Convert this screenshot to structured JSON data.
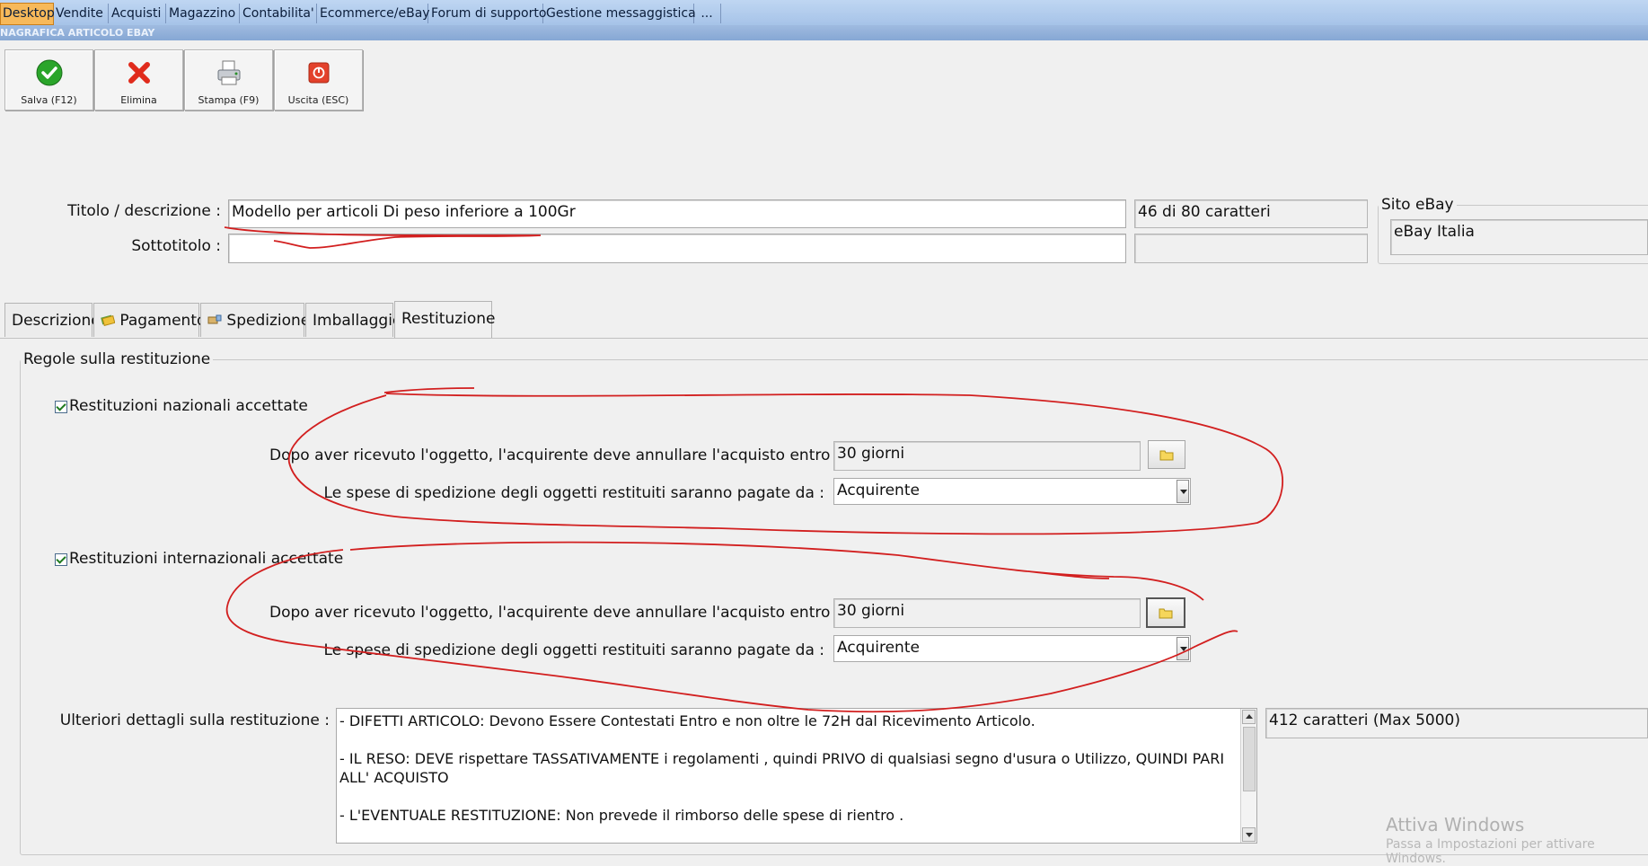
{
  "menu": {
    "tabs": [
      "Desktop",
      "Vendite",
      "Acquisti",
      "Magazzino",
      "Contabilita'",
      "Ecommerce/eBay",
      "Forum di supporto",
      "Gestione messaggistica",
      "..."
    ],
    "window_title": "NAGRAFICA ARTICOLO EBAY"
  },
  "toolbar": {
    "save_label": "Salva (F12)",
    "delete_label": "Elimina",
    "print_label": "Stampa (F9)",
    "exit_label": "Uscita (ESC)"
  },
  "form": {
    "title_label": "Titolo / descrizione :",
    "title_value": "Modello per articoli Di peso inferiore a 100Gr",
    "title_counter": "46 di 80 caratteri",
    "subtitle_label": "Sottotitolo :",
    "subtitle_value": "",
    "subtitle_counter": "",
    "site_group_label": "Sito eBay",
    "site_value": "eBay Italia"
  },
  "tabs": [
    "Descrizione",
    "Pagamento",
    "Spedizione",
    "Imballaggio",
    "Restituzione"
  ],
  "returns": {
    "group_label": "Regole sulla restituzione",
    "national": {
      "checkbox_label": "Restituzioni nazionali accettate",
      "checked": true,
      "period_label": "Dopo aver ricevuto l'oggetto, l'acquirente deve annullare l'acquisto entro :",
      "period_value": "30 giorni",
      "payer_label": "Le spese di spedizione degli oggetti restituiti saranno pagate da :",
      "payer_value": "Acquirente"
    },
    "international": {
      "checkbox_label": "Restituzioni internazionali accettate",
      "checked": true,
      "period_label": "Dopo aver ricevuto l'oggetto, l'acquirente deve annullare l'acquisto entro :",
      "period_value": "30 giorni",
      "payer_label": "Le spese di spedizione degli oggetti restituiti saranno pagate da :",
      "payer_value": "Acquirente"
    },
    "details_label": "Ulteriori dettagli sulla restituzione :",
    "details_lines": [
      "- DIFETTI ARTICOLO: Devono Essere Contestati Entro e non oltre le 72H dal Ricevimento Articolo.",
      "- IL RESO: DEVE rispettare TASSATIVAMENTE i regolamenti , quindi PRIVO di qualsiasi segno d'usura o Utilizzo, QUINDI PARI ALL' ACQUISTO",
      "- L'EVENTUALE RESTITUZIONE: Non prevede il rimborso delle spese di rientro ."
    ],
    "details_counter": "412 caratteri (Max 5000)"
  },
  "watermark": {
    "line1": "Attiva Windows",
    "line2": "Passa a Impostazioni per attivare Windows."
  },
  "colors": {
    "annotation": "#d21f1f",
    "menu_active": "#f7b95a",
    "menu_bar": "#a6c3e8"
  }
}
